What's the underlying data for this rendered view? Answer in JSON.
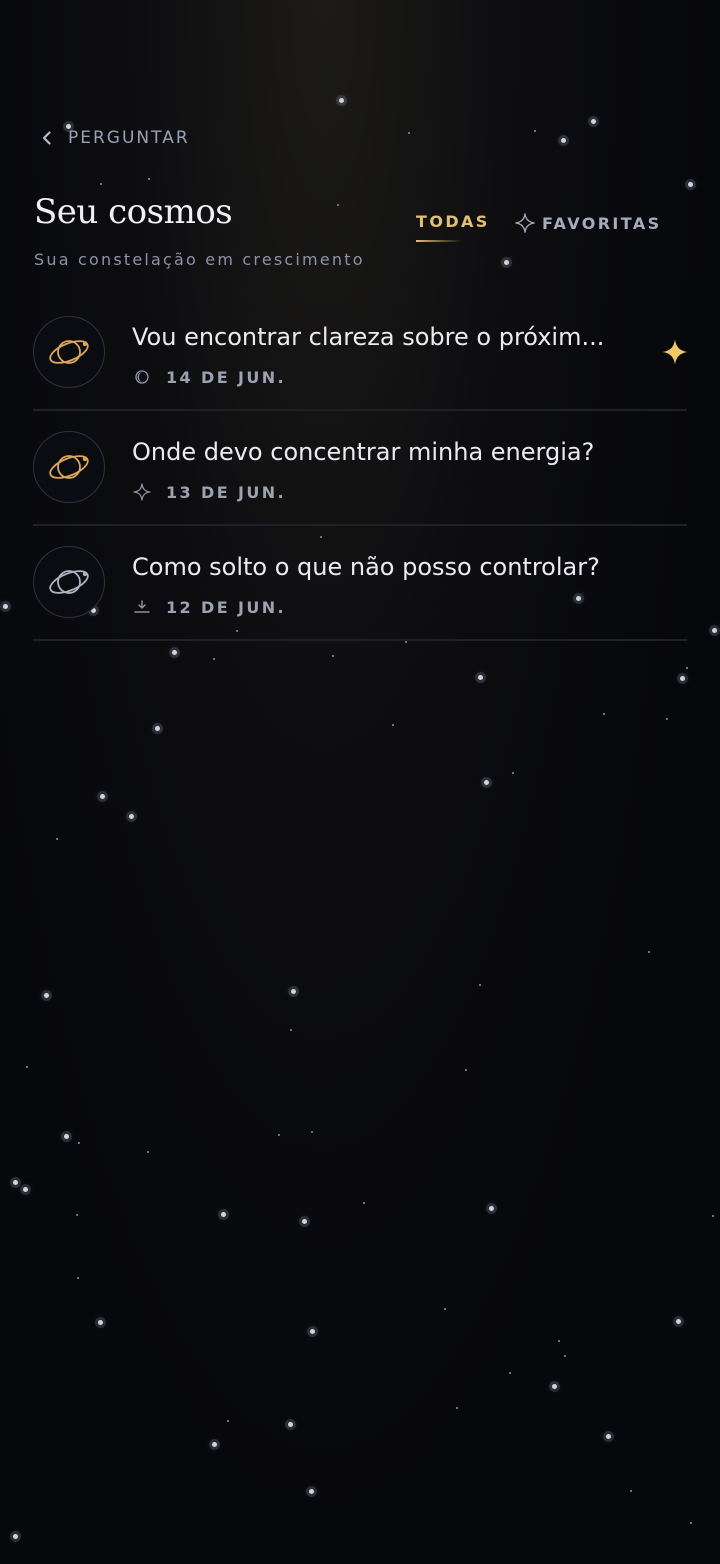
{
  "header": {
    "back_label": "PERGUNTAR",
    "title": "Seu cosmos",
    "subtitle": "Sua constelação em crescimento"
  },
  "tabs": {
    "all": {
      "label": "TODAS",
      "active": true
    },
    "favorites": {
      "label": "FAVORITAS",
      "active": false
    }
  },
  "entries": [
    {
      "question": "Vou encontrar clareza sobre o próxim...",
      "date": "14 DE JUN.",
      "meta_icon": "moon-phase-icon",
      "planet_color": "#d9a85a",
      "favorite": true
    },
    {
      "question": "Onde devo concentrar minha energia?",
      "date": "13 DE JUN.",
      "meta_icon": "sparkle-icon",
      "planet_color": "#d9a85a",
      "favorite": false
    },
    {
      "question": "Como solto o que não posso controlar?",
      "date": "12 DE JUN.",
      "meta_icon": "sunrise-icon",
      "planet_color": "#aeb3c2",
      "favorite": false
    }
  ],
  "colors": {
    "accent_gold": "#e2bf72",
    "text_muted": "#9da1b2",
    "background": "#07080c"
  }
}
